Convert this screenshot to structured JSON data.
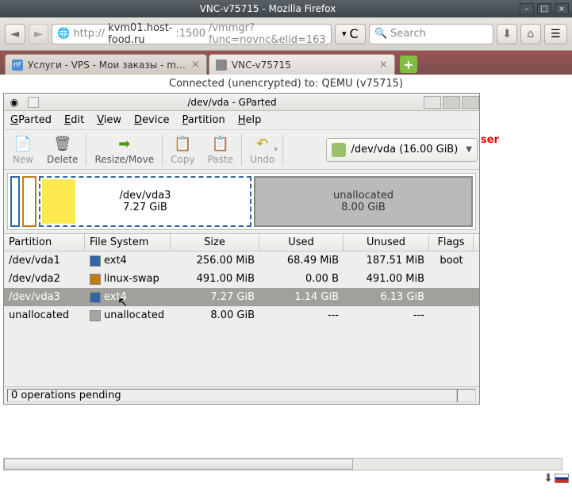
{
  "browser": {
    "title": "VNC-v75715 - Mozilla Firefox",
    "url_prefix": "http://",
    "url_host": "kvm01.host-food.ru",
    "url_port": ":1500",
    "url_path": "/vmmgr?func=novnc&elid=163",
    "search_placeholder": "Search",
    "tabs": [
      {
        "label": "Услуги - VPS - Мои заказы - manager.h…"
      },
      {
        "label": "VNC-v75715"
      }
    ]
  },
  "vnc": {
    "status": "Connected (unencrypted) to: QEMU (v75715)",
    "side_text": "ser"
  },
  "gparted": {
    "title": "/dev/vda - GParted",
    "menus": [
      "GParted",
      "Edit",
      "View",
      "Device",
      "Partition",
      "Help"
    ],
    "toolbar": {
      "new": "New",
      "delete": "Delete",
      "resize": "Resize/Move",
      "copy": "Copy",
      "paste": "Paste",
      "undo": "Undo"
    },
    "device_selector": "/dev/vda   (16.00 GiB)",
    "visual": {
      "selected_label": "/dev/vda3",
      "selected_size": "7.27 GiB",
      "unalloc_label": "unallocated",
      "unalloc_size": "8.00 GiB"
    },
    "columns": {
      "partition": "Partition",
      "filesystem": "File System",
      "size": "Size",
      "used": "Used",
      "unused": "Unused",
      "flags": "Flags"
    },
    "rows": [
      {
        "partition": "/dev/vda1",
        "fs": "ext4",
        "color": "#3465a4",
        "size": "256.00 MiB",
        "used": "68.49 MiB",
        "unused": "187.51 MiB",
        "flags": "boot"
      },
      {
        "partition": "/dev/vda2",
        "fs": "linux-swap",
        "color": "#c17d11",
        "size": "491.00 MiB",
        "used": "0.00 B",
        "unused": "491.00 MiB",
        "flags": ""
      },
      {
        "partition": "/dev/vda3",
        "fs": "ext4",
        "color": "#3465a4",
        "size": "7.27 GiB",
        "used": "1.14 GiB",
        "unused": "6.13 GiB",
        "flags": "",
        "selected": true
      },
      {
        "partition": "unallocated",
        "fs": "unallocated",
        "color": "#a4a4a0",
        "size": "8.00 GiB",
        "used": "---",
        "unused": "---",
        "flags": ""
      }
    ],
    "status": "0 operations pending"
  }
}
